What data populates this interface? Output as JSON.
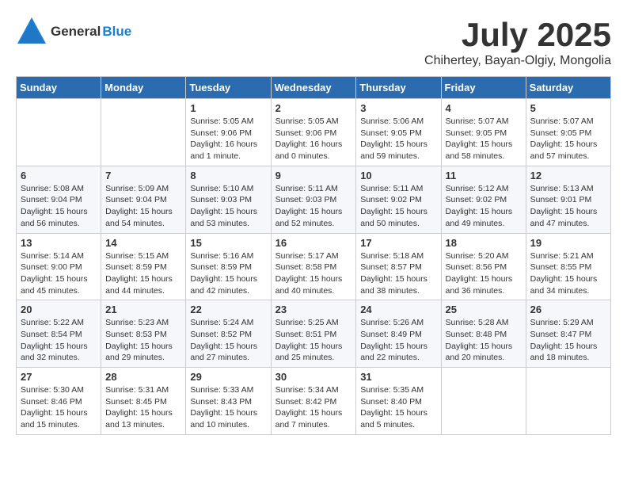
{
  "header": {
    "logo_general": "General",
    "logo_blue": "Blue",
    "title": "July 2025",
    "location": "Chihertey, Bayan-Olgiy, Mongolia"
  },
  "weekdays": [
    "Sunday",
    "Monday",
    "Tuesday",
    "Wednesday",
    "Thursday",
    "Friday",
    "Saturday"
  ],
  "weeks": [
    [
      {
        "day": "",
        "info": ""
      },
      {
        "day": "",
        "info": ""
      },
      {
        "day": "1",
        "info": "Sunrise: 5:05 AM\nSunset: 9:06 PM\nDaylight: 16 hours\nand 1 minute."
      },
      {
        "day": "2",
        "info": "Sunrise: 5:05 AM\nSunset: 9:06 PM\nDaylight: 16 hours\nand 0 minutes."
      },
      {
        "day": "3",
        "info": "Sunrise: 5:06 AM\nSunset: 9:05 PM\nDaylight: 15 hours\nand 59 minutes."
      },
      {
        "day": "4",
        "info": "Sunrise: 5:07 AM\nSunset: 9:05 PM\nDaylight: 15 hours\nand 58 minutes."
      },
      {
        "day": "5",
        "info": "Sunrise: 5:07 AM\nSunset: 9:05 PM\nDaylight: 15 hours\nand 57 minutes."
      }
    ],
    [
      {
        "day": "6",
        "info": "Sunrise: 5:08 AM\nSunset: 9:04 PM\nDaylight: 15 hours\nand 56 minutes."
      },
      {
        "day": "7",
        "info": "Sunrise: 5:09 AM\nSunset: 9:04 PM\nDaylight: 15 hours\nand 54 minutes."
      },
      {
        "day": "8",
        "info": "Sunrise: 5:10 AM\nSunset: 9:03 PM\nDaylight: 15 hours\nand 53 minutes."
      },
      {
        "day": "9",
        "info": "Sunrise: 5:11 AM\nSunset: 9:03 PM\nDaylight: 15 hours\nand 52 minutes."
      },
      {
        "day": "10",
        "info": "Sunrise: 5:11 AM\nSunset: 9:02 PM\nDaylight: 15 hours\nand 50 minutes."
      },
      {
        "day": "11",
        "info": "Sunrise: 5:12 AM\nSunset: 9:02 PM\nDaylight: 15 hours\nand 49 minutes."
      },
      {
        "day": "12",
        "info": "Sunrise: 5:13 AM\nSunset: 9:01 PM\nDaylight: 15 hours\nand 47 minutes."
      }
    ],
    [
      {
        "day": "13",
        "info": "Sunrise: 5:14 AM\nSunset: 9:00 PM\nDaylight: 15 hours\nand 45 minutes."
      },
      {
        "day": "14",
        "info": "Sunrise: 5:15 AM\nSunset: 8:59 PM\nDaylight: 15 hours\nand 44 minutes."
      },
      {
        "day": "15",
        "info": "Sunrise: 5:16 AM\nSunset: 8:59 PM\nDaylight: 15 hours\nand 42 minutes."
      },
      {
        "day": "16",
        "info": "Sunrise: 5:17 AM\nSunset: 8:58 PM\nDaylight: 15 hours\nand 40 minutes."
      },
      {
        "day": "17",
        "info": "Sunrise: 5:18 AM\nSunset: 8:57 PM\nDaylight: 15 hours\nand 38 minutes."
      },
      {
        "day": "18",
        "info": "Sunrise: 5:20 AM\nSunset: 8:56 PM\nDaylight: 15 hours\nand 36 minutes."
      },
      {
        "day": "19",
        "info": "Sunrise: 5:21 AM\nSunset: 8:55 PM\nDaylight: 15 hours\nand 34 minutes."
      }
    ],
    [
      {
        "day": "20",
        "info": "Sunrise: 5:22 AM\nSunset: 8:54 PM\nDaylight: 15 hours\nand 32 minutes."
      },
      {
        "day": "21",
        "info": "Sunrise: 5:23 AM\nSunset: 8:53 PM\nDaylight: 15 hours\nand 29 minutes."
      },
      {
        "day": "22",
        "info": "Sunrise: 5:24 AM\nSunset: 8:52 PM\nDaylight: 15 hours\nand 27 minutes."
      },
      {
        "day": "23",
        "info": "Sunrise: 5:25 AM\nSunset: 8:51 PM\nDaylight: 15 hours\nand 25 minutes."
      },
      {
        "day": "24",
        "info": "Sunrise: 5:26 AM\nSunset: 8:49 PM\nDaylight: 15 hours\nand 22 minutes."
      },
      {
        "day": "25",
        "info": "Sunrise: 5:28 AM\nSunset: 8:48 PM\nDaylight: 15 hours\nand 20 minutes."
      },
      {
        "day": "26",
        "info": "Sunrise: 5:29 AM\nSunset: 8:47 PM\nDaylight: 15 hours\nand 18 minutes."
      }
    ],
    [
      {
        "day": "27",
        "info": "Sunrise: 5:30 AM\nSunset: 8:46 PM\nDaylight: 15 hours\nand 15 minutes."
      },
      {
        "day": "28",
        "info": "Sunrise: 5:31 AM\nSunset: 8:45 PM\nDaylight: 15 hours\nand 13 minutes."
      },
      {
        "day": "29",
        "info": "Sunrise: 5:33 AM\nSunset: 8:43 PM\nDaylight: 15 hours\nand 10 minutes."
      },
      {
        "day": "30",
        "info": "Sunrise: 5:34 AM\nSunset: 8:42 PM\nDaylight: 15 hours\nand 7 minutes."
      },
      {
        "day": "31",
        "info": "Sunrise: 5:35 AM\nSunset: 8:40 PM\nDaylight: 15 hours\nand 5 minutes."
      },
      {
        "day": "",
        "info": ""
      },
      {
        "day": "",
        "info": ""
      }
    ]
  ]
}
